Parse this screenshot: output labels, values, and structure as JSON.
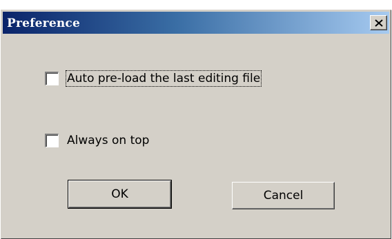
{
  "window": {
    "title": "Preference"
  },
  "options": {
    "auto_preload_label": "Auto pre-load the last editing file",
    "auto_preload_checked": false,
    "always_on_top_label": "Always on top",
    "always_on_top_checked": false
  },
  "buttons": {
    "ok_label": "OK",
    "cancel_label": "Cancel"
  },
  "icons": {
    "close": "close-icon"
  },
  "colors": {
    "titlebar_start": "#0a246a",
    "titlebar_end": "#a6caf0",
    "window_face": "#d4d0c8"
  }
}
